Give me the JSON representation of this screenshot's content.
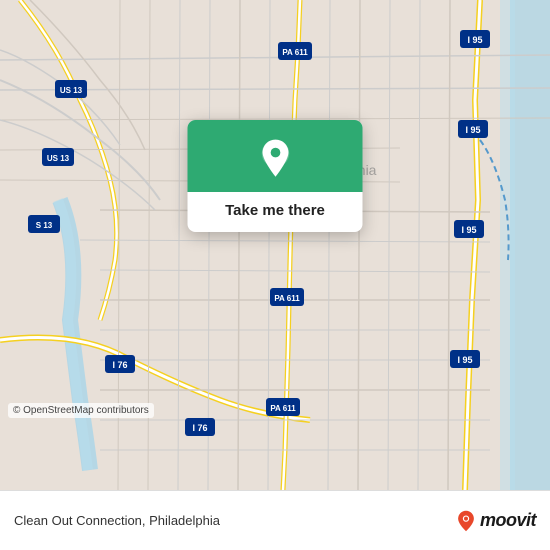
{
  "map": {
    "background_color": "#e8e0d8",
    "copyright": "© OpenStreetMap contributors"
  },
  "popup": {
    "button_label": "Take me there",
    "pin_color": "#2eaa72",
    "pin_icon": "location-pin-icon"
  },
  "bottom_bar": {
    "location_text": "Clean Out Connection, Philadelphia",
    "brand_name": "moovit"
  }
}
